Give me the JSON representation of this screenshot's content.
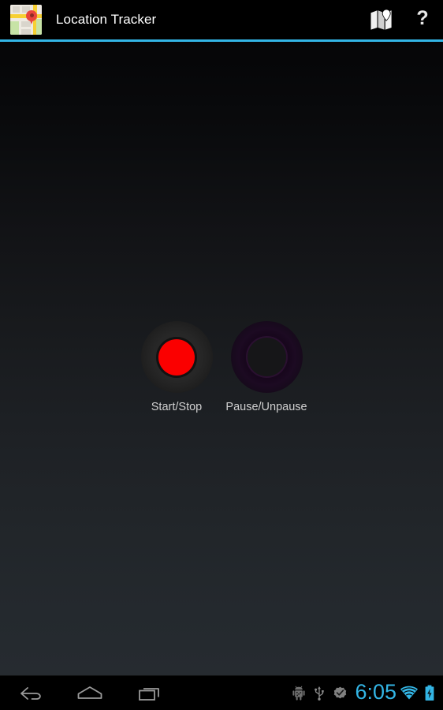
{
  "app": {
    "title": "Location Tracker",
    "icon_name": "maps-app-icon",
    "accent_color": "#33b5e5",
    "background_top_color": "#050507",
    "background_bottom_color": "#262b30"
  },
  "action_bar": {
    "items": [
      {
        "name": "map-icon",
        "label": "Map",
        "glyph": "map"
      },
      {
        "name": "help-icon",
        "label": "Help",
        "glyph": "?"
      }
    ]
  },
  "main": {
    "buttons": [
      {
        "name": "start-stop-button",
        "label": "Start/Stop",
        "state": "enabled",
        "indicator_color": "#fb0000"
      },
      {
        "name": "pause-unpause-button",
        "label": "Pause/Unpause",
        "state": "disabled",
        "indicator_color": "#161618"
      }
    ]
  },
  "nav_bar": {
    "buttons": [
      {
        "name": "back-button",
        "label": "Back"
      },
      {
        "name": "home-button",
        "label": "Home"
      },
      {
        "name": "recents-button",
        "label": "Recent apps"
      }
    ],
    "status": {
      "icons": [
        {
          "name": "android-debug-icon",
          "label": "USB debugging"
        },
        {
          "name": "usb-icon",
          "label": "USB connected"
        },
        {
          "name": "check-badge-icon",
          "label": "Verified"
        }
      ],
      "time": "6:05",
      "time_color": "#33b5e5",
      "wifi": {
        "name": "wifi-icon",
        "label": "Wi-Fi connected"
      },
      "battery": {
        "name": "battery-charging-icon",
        "label": "Charging"
      }
    }
  }
}
